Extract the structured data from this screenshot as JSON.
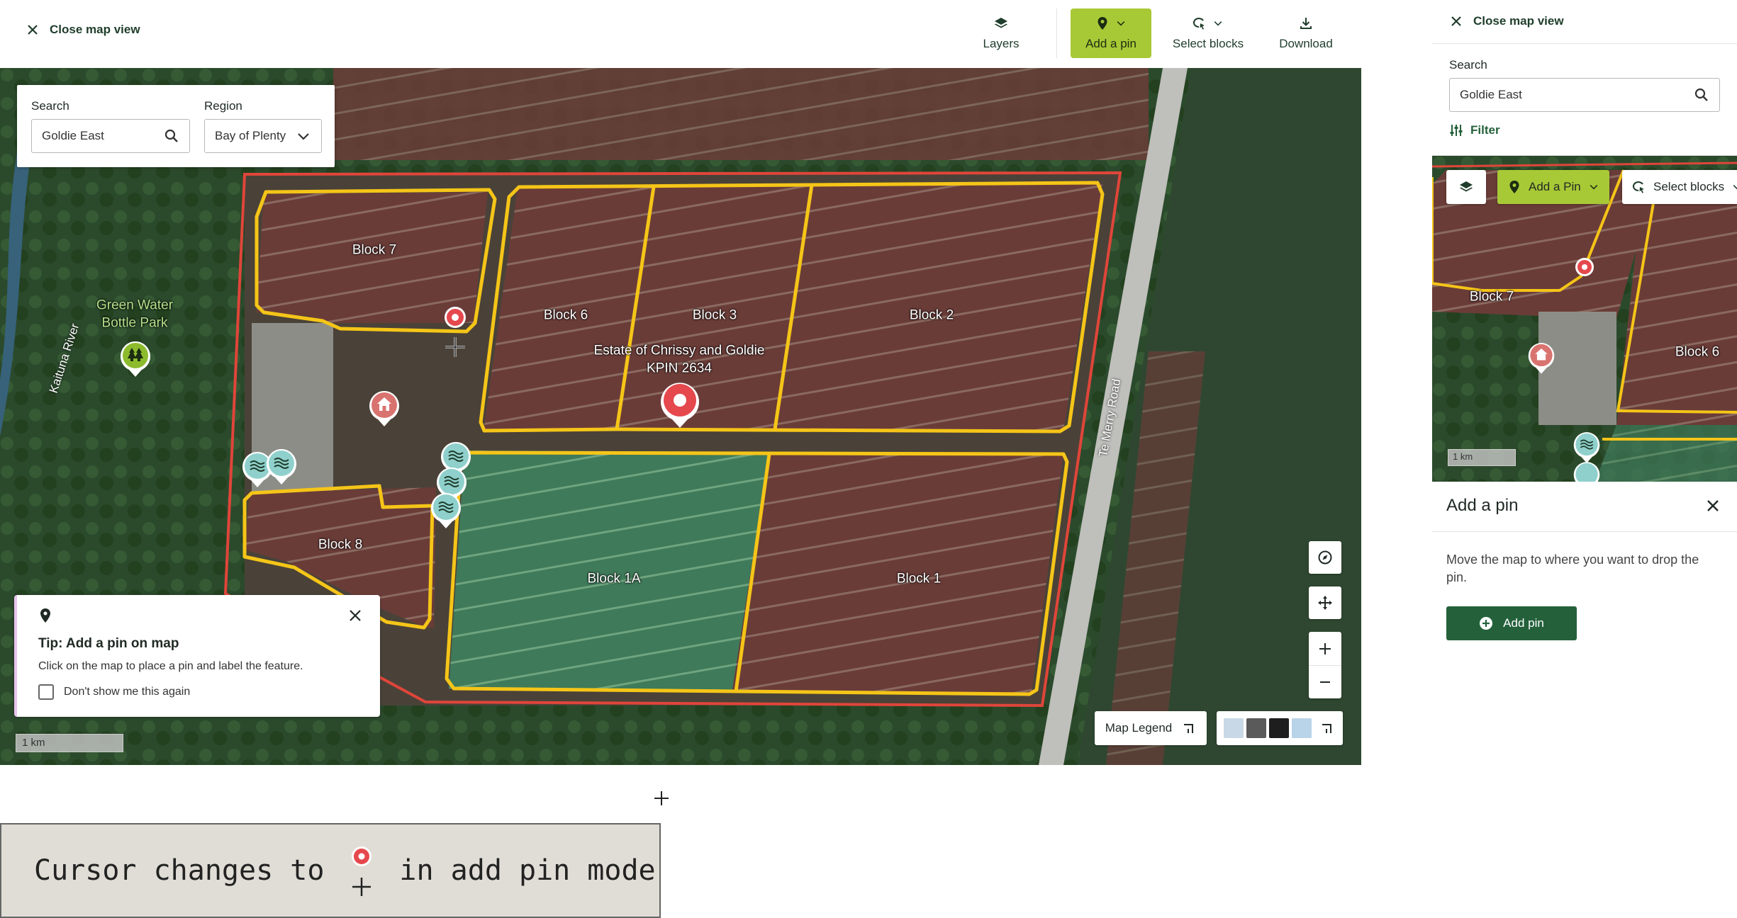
{
  "desktop": {
    "close_label": "Close map view",
    "toolbar": {
      "layers": "Layers",
      "add_pin": "Add a pin",
      "select_blocks": "Select blocks",
      "download": "Download"
    },
    "search": {
      "label": "Search",
      "value": "Goldie East",
      "region_label": "Region",
      "region_value": "Bay of Plenty"
    },
    "map_labels": {
      "block7": "Block 7",
      "block6": "Block 6",
      "block3": "Block 3",
      "block2": "Block 2",
      "block8": "Block 8",
      "block1a": "Block 1A",
      "block1": "Block 1",
      "estate_line1": "Estate of Chrissy and Goldie",
      "estate_line2": "KPIN 2634",
      "park_line1": "Green Water",
      "park_line2": "Bottle Park",
      "river": "Kaituna River",
      "road": "Te Merry Road"
    },
    "tip": {
      "title": "Tip: Add a pin on map",
      "body": "Click on the map to place a pin and label the feature.",
      "checkbox_label": "Don't show me this again",
      "checked": false
    },
    "scale": "1 km",
    "legend_label": "Map Legend",
    "basemap_options": [
      "#c9d8e6",
      "#5a5a5a",
      "#1e1e1e",
      "#b9d3e8"
    ]
  },
  "mobile": {
    "close_label": "Close map view",
    "search_label": "Search",
    "search_value": "Goldie East",
    "filter_label": "Filter",
    "add_pin_label": "Add a Pin",
    "select_blocks_label": "Select blocks",
    "map_labels": {
      "block7": "Block 7",
      "block6": "Block 6"
    },
    "scale": "1 km",
    "sheet": {
      "title": "Add a pin",
      "body": "Move the map to where you want to drop the pin.",
      "button": "Add pin"
    }
  },
  "caption": {
    "before": "Cursor changes to",
    "after": "in add pin mode"
  },
  "colors": {
    "accent_green": "#a8c936",
    "dark_green": "#24613b",
    "block_outline": "#f5c518",
    "property_outline": "#e0453a",
    "pin_red": "#e5484d"
  }
}
